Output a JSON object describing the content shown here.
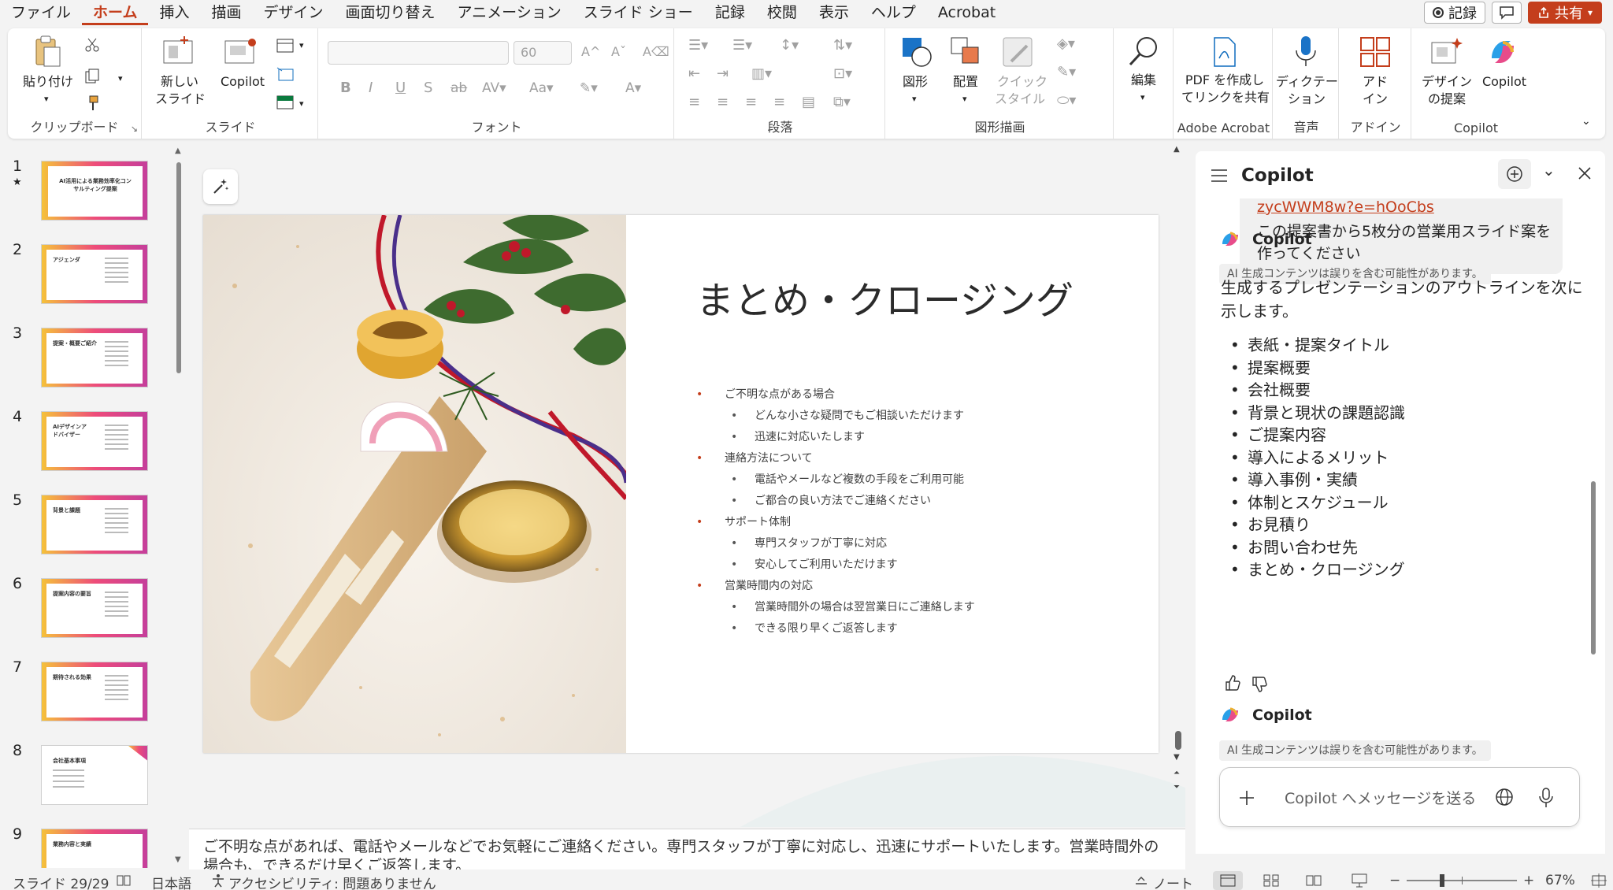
{
  "menu": {
    "items": [
      "ファイル",
      "ホーム",
      "挿入",
      "描画",
      "デザイン",
      "画面切り替え",
      "アニメーション",
      "スライド ショー",
      "記録",
      "校閲",
      "表示",
      "ヘルプ",
      "Acrobat"
    ],
    "active": "ホーム",
    "record_label": "記録",
    "share_label": "共有"
  },
  "ribbon": {
    "clipboard": {
      "paste": "貼り付け",
      "label": "クリップボード"
    },
    "slides": {
      "new_slide_1": "新しい",
      "new_slide_2": "スライド",
      "copilot": "Copilot",
      "label": "スライド"
    },
    "font": {
      "font_name": "",
      "font_size": "60",
      "label": "フォント"
    },
    "paragraph": {
      "label": "段落"
    },
    "drawing": {
      "shapes": "図形",
      "arrange": "配置",
      "quick_style_1": "クイック",
      "quick_style_2": "スタイル",
      "label": "図形描画"
    },
    "editing": {
      "edit": "編集"
    },
    "acrobat": {
      "pdf_1": "PDF を作成し",
      "pdf_2": "てリンクを共有",
      "label": "Adobe Acrobat"
    },
    "voice": {
      "dictate_1": "ディクテー",
      "dictate_2": "ション",
      "label": "音声"
    },
    "addin": {
      "addin_1": "アド",
      "addin_2": "イン",
      "label": "アドイン"
    },
    "copilot": {
      "designer_1": "デザイン",
      "designer_2": "の提案",
      "copilot": "Copilot",
      "label": "Copilot"
    }
  },
  "thumbnails": [
    {
      "num": "1",
      "star": "★",
      "title": "AI活用による業務効率化コンサルティング提案"
    },
    {
      "num": "2",
      "title": "アジェンダ"
    },
    {
      "num": "3",
      "title": "提案・概要ご紹介"
    },
    {
      "num": "4",
      "title": "AIデザインアドバイザー"
    },
    {
      "num": "5",
      "title": "背景と課題"
    },
    {
      "num": "6",
      "title": "提案内容の要旨"
    },
    {
      "num": "7",
      "title": "期待される効果"
    },
    {
      "num": "8",
      "title": "会社基本事項"
    },
    {
      "num": "9",
      "title": "業務内容と実績"
    }
  ],
  "slide": {
    "title": "まとめ・クロージング",
    "bullets": [
      {
        "level": 1,
        "text": "ご不明な点がある場合"
      },
      {
        "level": 2,
        "text": "どんな小さな疑問でもご相談いただけます"
      },
      {
        "level": 2,
        "text": "迅速に対応いたします"
      },
      {
        "level": 1,
        "text": "連絡方法について"
      },
      {
        "level": 2,
        "text": "電話やメールなど複数の手段をご利用可能"
      },
      {
        "level": 2,
        "text": "ご都合の良い方法でご連絡ください"
      },
      {
        "level": 1,
        "text": "サポート体制"
      },
      {
        "level": 2,
        "text": "専門スタッフが丁寧に対応"
      },
      {
        "level": 2,
        "text": "安心してご利用いただけます"
      },
      {
        "level": 1,
        "text": "営業時間内の対応"
      },
      {
        "level": 2,
        "text": "営業時間外の場合は翌営業日にご連絡します"
      },
      {
        "level": 2,
        "text": "できる限り早くご返答します"
      }
    ]
  },
  "notes": "ご不明な点があれば、電話やメールなどでお気軽にご連絡ください。専門スタッフが丁寧に対応し、迅速にサポートいたします。営業時間外の場合も、できるだけ早くご返答します。",
  "copilot": {
    "title": "Copilot",
    "user_link": "zycWWM8w?e=hOoCbs",
    "user_message": "この提案書から5枚分の営業用スライド案を作ってください",
    "assistant_name": "Copilot",
    "disclaimer": "AI 生成コンテンツは誤りを含む可能性があります。",
    "intro": "生成するプレゼンテーションのアウトラインを次に示します。",
    "outline": [
      "表紙・提案タイトル",
      "提案概要",
      "会社概要",
      "背景と現状の課題認識",
      "ご提案内容",
      "導入によるメリット",
      "導入事例・実績",
      "体制とスケジュール",
      "お見積り",
      "お問い合わせ先",
      "まとめ・クロージング"
    ],
    "assistant_name_2": "Copilot",
    "disclaimer_2": "AI 生成コンテンツは誤りを含む可能性があります。",
    "input_placeholder": "Copilot へメッセージを送る"
  },
  "status": {
    "slide": "スライド 29/29",
    "language": "日本語",
    "accessibility": "アクセシビリティ: 問題ありません",
    "notes": "ノート",
    "zoom": "67%"
  },
  "colors": {
    "accent": "#c43e1c",
    "link": "#c43e1c"
  }
}
